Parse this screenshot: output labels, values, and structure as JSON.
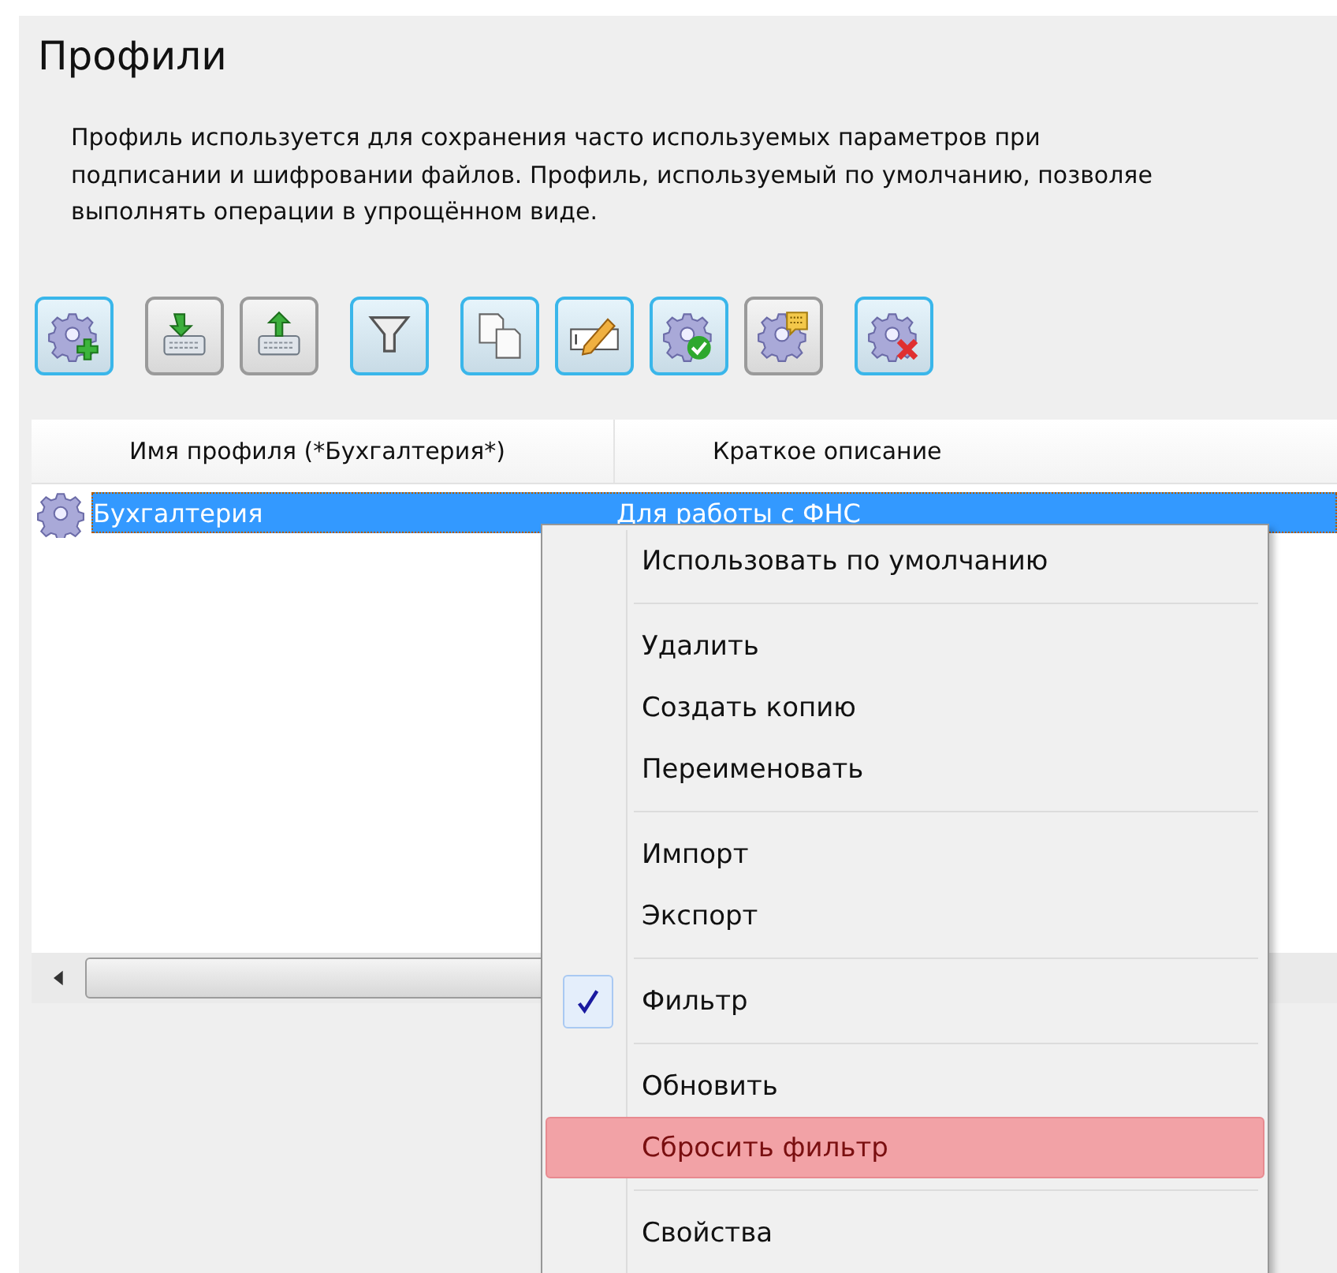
{
  "page": {
    "title": "Профили",
    "description": "Профиль используется для сохранения часто используемых параметров при\nподписании и шифровании файлов. Профиль, используемый по умолчанию, позволяе\nвыполнять операции в упрощённом виде."
  },
  "toolbar": [
    [
      {
        "kind": "gear-add",
        "active": true
      }
    ],
    [
      {
        "kind": "import",
        "active": false
      },
      {
        "kind": "export",
        "active": false
      }
    ],
    [
      {
        "kind": "filter",
        "active": true
      }
    ],
    [
      {
        "kind": "copy",
        "active": true
      },
      {
        "kind": "rename",
        "active": true
      },
      {
        "kind": "gear-check",
        "active": true
      },
      {
        "kind": "gear-note",
        "active": false
      }
    ],
    [
      {
        "kind": "gear-delete",
        "active": true
      }
    ]
  ],
  "table": {
    "columns": [
      "Имя профиля (*Бухгалтерия*)",
      "Краткое описание"
    ],
    "rows": [
      {
        "name": "Бухгалтерия",
        "description": "Для работы с ФНС",
        "selected": true
      }
    ]
  },
  "context_menu": [
    [
      {
        "label": "Использовать по умолчанию",
        "checked": false,
        "selected": false
      }
    ],
    [
      {
        "label": "Удалить",
        "checked": false,
        "selected": false
      },
      {
        "label": "Создать копию",
        "checked": false,
        "selected": false
      },
      {
        "label": "Переименовать",
        "checked": false,
        "selected": false
      }
    ],
    [
      {
        "label": "Импорт",
        "checked": false,
        "selected": false
      },
      {
        "label": "Экспорт",
        "checked": false,
        "selected": false
      }
    ],
    [
      {
        "label": "Фильтр",
        "checked": true,
        "selected": false
      }
    ],
    [
      {
        "label": "Обновить",
        "checked": false,
        "selected": false
      },
      {
        "label": "Сбросить фильтр",
        "checked": false,
        "selected": true
      }
    ],
    [
      {
        "label": "Свойства",
        "checked": false,
        "selected": false
      }
    ]
  ]
}
